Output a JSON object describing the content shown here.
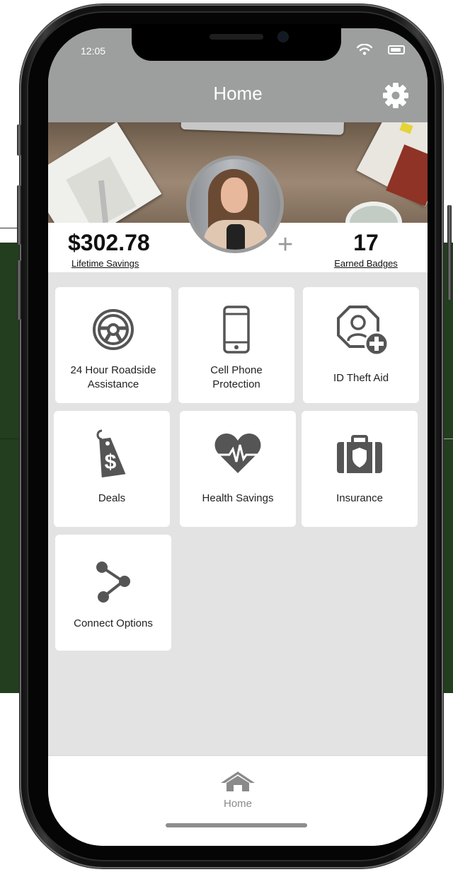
{
  "status_bar": {
    "time": "12:05"
  },
  "header": {
    "title": "Home",
    "settings_icon": "gear-icon"
  },
  "profile": {
    "lifetime_savings_value": "$302.78",
    "lifetime_savings_label": "Lifetime Savings",
    "earned_badges_value": "17",
    "earned_badges_label": "Earned Badges",
    "add_symbol": "+"
  },
  "tiles": [
    {
      "id": "roadside",
      "label_line1": "24 Hour Roadside",
      "label_line2": "Assistance",
      "icon": "steering-wheel-icon"
    },
    {
      "id": "cell-phone",
      "label_line1": "Cell Phone",
      "label_line2": "Protection",
      "icon": "cell-phone-icon"
    },
    {
      "id": "id-theft",
      "label": "ID Theft Aid",
      "icon": "id-theft-icon"
    },
    {
      "id": "deals",
      "label": "Deals",
      "icon": "price-tag-icon"
    },
    {
      "id": "health",
      "label": "Health Savings",
      "icon": "heartbeat-icon"
    },
    {
      "id": "insurance",
      "label": "Insurance",
      "icon": "briefcase-shield-icon"
    },
    {
      "id": "connect",
      "label": "Connect Options",
      "icon": "share-icon"
    }
  ],
  "tabbar": {
    "home_label": "Home",
    "home_icon": "home-icon"
  },
  "colors": {
    "header": "#9d9e9e",
    "content_bg": "#e3e3e3",
    "icon": "#555555",
    "page_bg_green": "#233d1f"
  }
}
